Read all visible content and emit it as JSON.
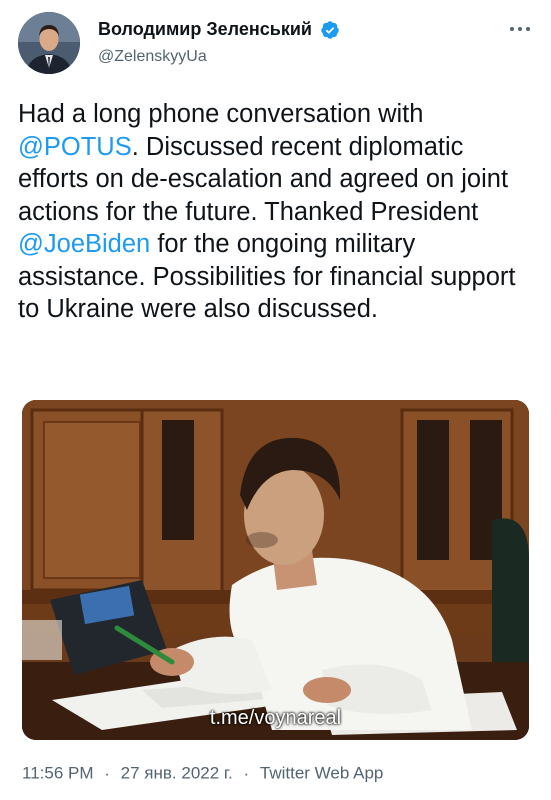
{
  "author": {
    "display_name": "Володимир Зеленський",
    "handle": "@ZelenskyyUa",
    "verified_icon": "verified-badge-icon",
    "avatar_icon": "avatar-photo"
  },
  "more_icon": "more-horizontal-icon",
  "tweet": {
    "t1": "Had a long phone conversation with ",
    "m1": "@POTUS",
    "t2": ". Discussed recent diplomatic efforts on de-escalation and agreed on joint actions for the future. Thanked President ",
    "m2": "@JoeBiden",
    "t3": " for the ongoing military assistance. Possibilities for financial support to Ukraine were also discussed."
  },
  "media": {
    "watermark": "t.me/voynareal"
  },
  "meta": {
    "time": "11:56 PM",
    "date": "27 янв. 2022 г.",
    "source": "Twitter Web App",
    "separator": "·"
  },
  "colors": {
    "mention": "#1d9bf0",
    "secondary_text": "#536471",
    "verified": "#1d9bf0"
  }
}
